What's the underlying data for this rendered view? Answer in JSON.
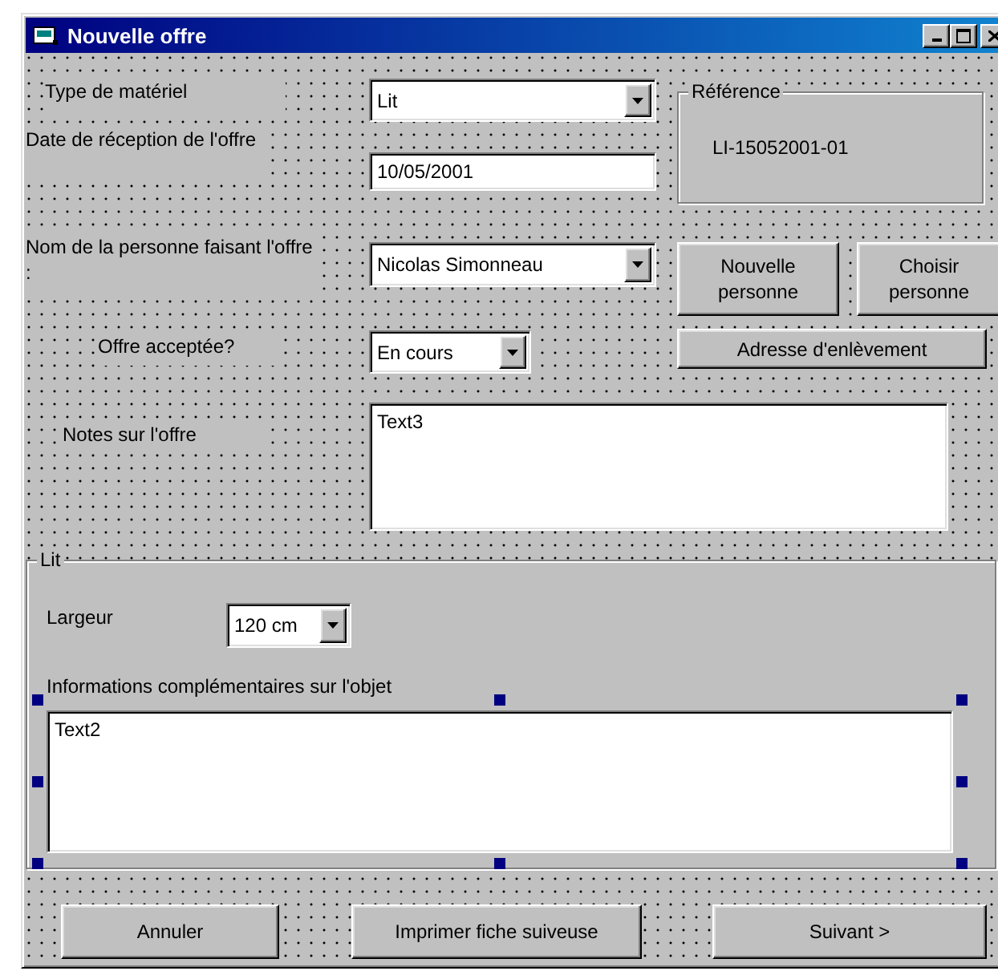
{
  "window": {
    "title": "Nouvelle offre"
  },
  "fields": [
    {
      "kind": "combo",
      "label": "Type de matériel",
      "value": "Lit"
    },
    {
      "kind": "text",
      "label": "Date de réception de l'offre",
      "value": "10/05/2001"
    },
    {
      "kind": "combo",
      "label": "Nom de la personne faisant l'offre :",
      "value": "Nicolas Simonneau"
    },
    {
      "kind": "combo",
      "label": "Offre acceptée?",
      "value": "En cours"
    },
    {
      "kind": "memo",
      "label": "Notes sur l'offre",
      "value": "Text3"
    }
  ],
  "reference": {
    "title": "Référence",
    "value": "LI-15052001-01"
  },
  "person_buttons": [
    "Nouvelle personne",
    "Choisir personne"
  ],
  "address_button": "Adresse d'enlèvement",
  "object_frame": {
    "title": "Lit",
    "width_label": "Largeur",
    "width_value": "120 cm",
    "info_label": "Informations complémentaires sur l'objet",
    "info_value": "Text2",
    "info_selected": true
  },
  "buttons": [
    "Annuler",
    "Imprimer fiche suiveuse",
    "Suivant >"
  ]
}
